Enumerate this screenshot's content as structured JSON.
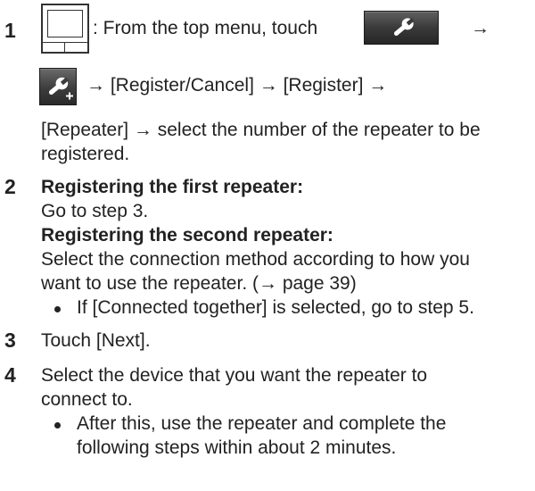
{
  "step1": {
    "number": "1",
    "line1_text": ": From the top menu, touch",
    "arrow1": "→",
    "line2_text": "→ [Register/Cancel] → [Register] →",
    "line3_text": "[Repeater] → select the number of the repeater to be",
    "line4_text": "registered."
  },
  "step2": {
    "number": "2",
    "heading1": "Registering the first repeater:",
    "line1": "Go to step 3.",
    "heading2": "Registering the second repeater:",
    "line2a": "Select the connection method according to how you",
    "line2b": "want to use the repeater. (→ page 39)",
    "bullet": "If [Connected together] is selected, go to step 5."
  },
  "step3": {
    "number": "3",
    "text": "Touch [Next]."
  },
  "step4": {
    "number": "4",
    "line1": "Select the device that you want the repeater to",
    "line2": "connect to.",
    "bullet_line1": "After this, use the repeater and complete the",
    "bullet_line2": "following steps within about 2 minutes."
  },
  "icons": {
    "monitor": "monitor-icon",
    "settings_button": "wrench-icon",
    "register_button": "wrench-plus-icon"
  },
  "colors": {
    "text": "#222222",
    "button_dark": "#333333",
    "icon_white": "#ffffff"
  }
}
